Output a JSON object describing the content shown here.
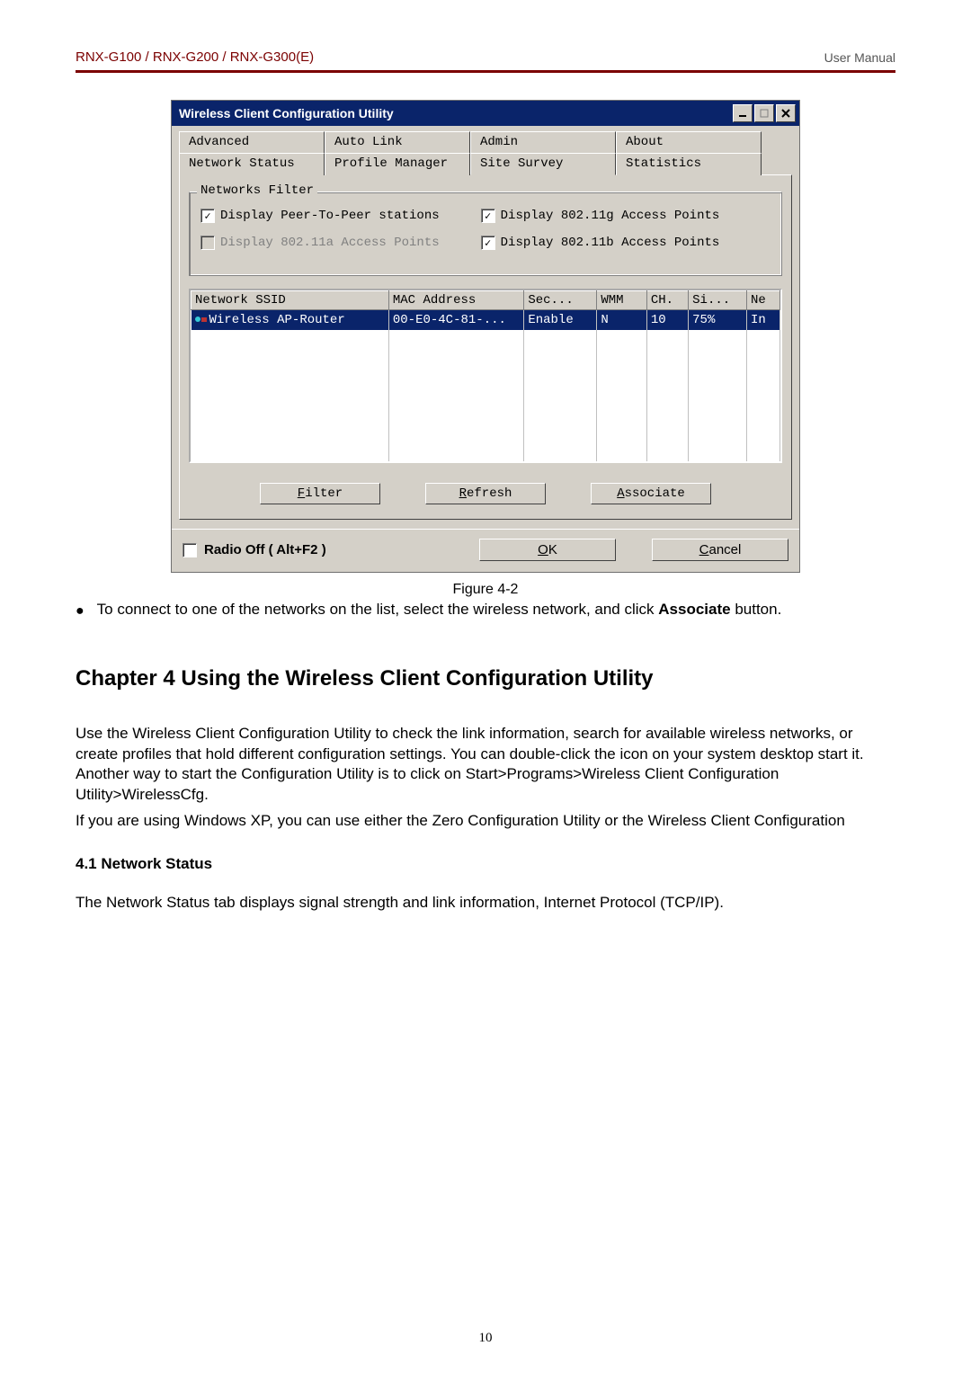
{
  "header": {
    "models": "RNX-G100  /  RNX-G200  /  RNX-G300(E)",
    "right": "User  Manual"
  },
  "dialog": {
    "title": "Wireless Client Configuration Utility",
    "tabs_top": [
      "Advanced",
      "Auto Link",
      "Admin",
      "About"
    ],
    "tabs_bottom": [
      "Network Status",
      "Profile Manager",
      "Site Survey",
      "Statistics"
    ],
    "active_tab": "Site Survey",
    "filter_group": {
      "legend": "Networks Filter",
      "checks": [
        {
          "label": "Display Peer-To-Peer stations",
          "checked": true,
          "disabled": false
        },
        {
          "label": "Display 802.11g Access Points",
          "checked": true,
          "disabled": false
        },
        {
          "label": "Display 802.11a Access Points",
          "checked": false,
          "disabled": true
        },
        {
          "label": "Display 802.11b Access Points",
          "checked": true,
          "disabled": false
        }
      ]
    },
    "table": {
      "columns": [
        "Network SSID",
        "MAC Address",
        "Sec...",
        "WMM",
        "CH.",
        "Si...",
        "Ne"
      ],
      "col_widths": [
        "190px",
        "130px",
        "70px",
        "48px",
        "40px",
        "56px",
        "32px"
      ],
      "rows": [
        {
          "ssid": "Wireless AP-Router",
          "mac": "00-E0-4C-81-...",
          "sec": "Enable",
          "wmm": "N",
          "ch": "10",
          "si": "75%",
          "ne": "In",
          "selected": true
        }
      ],
      "blank_rows": 7
    },
    "buttons": {
      "filter": {
        "mnemonic": "F",
        "rest": "ilter"
      },
      "refresh": {
        "mnemonic": "R",
        "rest": "efresh"
      },
      "associate": {
        "mnemonic": "A",
        "rest": "ssociate"
      }
    },
    "footer": {
      "radio_off": "Radio Off  ( Alt+F2 )",
      "ok": {
        "mnemonic": "O",
        "rest": "K"
      },
      "cancel": {
        "mnemonic": "C",
        "rest": "ancel"
      }
    }
  },
  "figure": {
    "caption": "Figure 4-2",
    "bullet": "To connect to one of the networks on the list, select the wireless network, and click ",
    "bullet_bold": "Associate",
    "bullet_tail": " button."
  },
  "chapter": {
    "title": "Chapter 4 Using the Wireless Client Configuration Utility",
    "p1": "Use the Wireless Client Configuration Utility to check the link information, search for available wireless networks, or create profiles that hold different configuration settings. You can double-click the icon on your system desktop start it. Another way to start the Configuration Utility is to click on Start>Programs>Wireless Client Configuration Utility>WirelessCfg.",
    "p2": "If you are using Windows XP, you can use either the Zero Configuration Utility or the Wireless Client Configuration",
    "sub": "4.1 Network Status",
    "p3": "The Network Status tab displays signal strength and link information, Internet Protocol (TCP/IP)."
  },
  "page_number": "10"
}
